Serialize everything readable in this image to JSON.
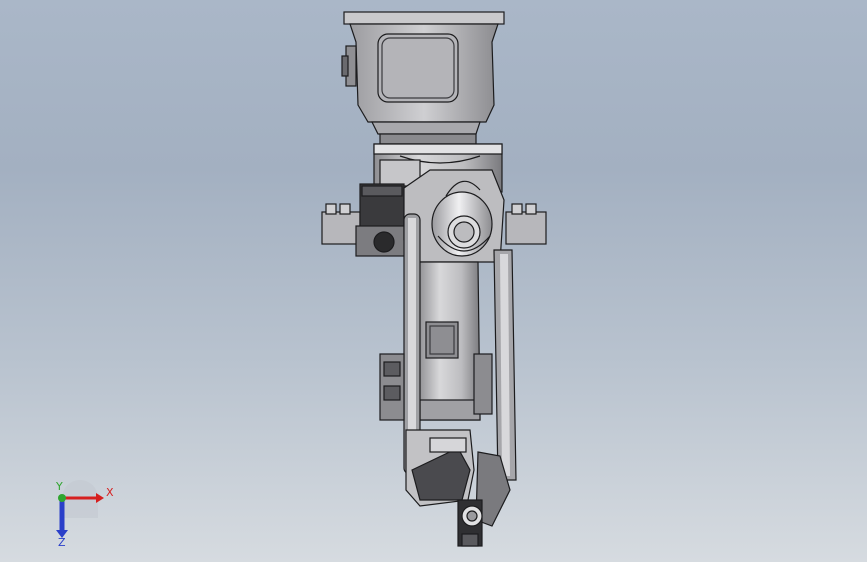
{
  "viewport": {
    "background_top": "#a3b0c1",
    "background_bottom": "#d6dbe0"
  },
  "model": {
    "icon": "robot-arm-model",
    "colors": {
      "metal_light": "#d4d4d6",
      "metal_mid": "#a9a9ad",
      "metal_dark": "#5e5e62",
      "edge": "#1c1c1e",
      "black": "#2a2a2c"
    }
  },
  "triad": {
    "x_label": "X",
    "y_label": "Y",
    "z_label": "Z",
    "x_color": "#d61f1f",
    "y_color": "#2fa52f",
    "z_color": "#2a3fc9"
  }
}
